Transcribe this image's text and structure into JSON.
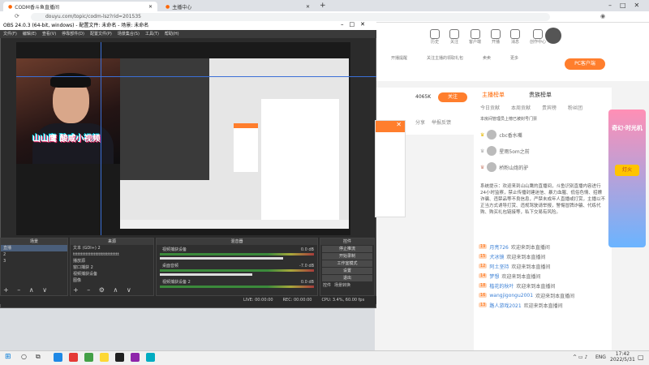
{
  "browser": {
    "tabs": [
      {
        "title": "CODM香斗鱼直播间"
      },
      {
        "title": "主播中心"
      }
    ],
    "new_tab": "+",
    "url": "douyu.com/topic/codm-lsz?rid=201535"
  },
  "obs": {
    "title": "OBS 24.0.3 (64-bit, windows) - 配置文件: 未命名 - 场景: 未命名",
    "menu": [
      "文件(F)",
      "编辑(E)",
      "查看(V)",
      "停靠部件(D)",
      "配置文件(P)",
      "场景集合(S)",
      "工具(T)",
      "帮助(H)"
    ],
    "watermark": "山山鹰  酸咸小视频",
    "docks": {
      "scenes": {
        "title": "场景",
        "items": [
          "直播",
          "2",
          "3"
        ]
      },
      "sources": {
        "title": "来源",
        "items": [
          "文本 (GDI+) 2",
          "ttttttttttttttttttttttttttttt",
          "播放源",
          "窗口捕获 2",
          "视频捕获设备",
          "图像"
        ]
      },
      "mixer": {
        "title": "混音器",
        "channels": [
          {
            "name": "视频捕获设备",
            "db": "0.0 dB"
          },
          {
            "name": "桌面音频",
            "db": "-7.0 dB"
          },
          {
            "name": "视频捕获设备 2",
            "db": "0.0 dB"
          }
        ]
      },
      "controls": {
        "title": "控件",
        "buttons": [
          "停止推流",
          "开始录制",
          "工作室模式",
          "设置",
          "退出"
        ],
        "tabs": [
          "控件",
          "场景转换"
        ]
      }
    },
    "status": [
      "LIVE: 00:00:00",
      "REC: 00:00:00",
      "CPU: 3.4%, 60.00 fps"
    ]
  },
  "douyu": {
    "nav": [
      "历史",
      "关注",
      "客户端",
      "开播",
      "消息",
      "创作中心"
    ],
    "pc_button": "PC客户端",
    "categories": [
      "开播提醒",
      "关注主播的领取礼包",
      "卖卖",
      "更多"
    ],
    "room_btns": [
      "分享",
      "举报反馈"
    ],
    "follow_count": "4065K",
    "follow_button": "关注",
    "panel_tabs": [
      "主播榜单",
      "贵族榜单"
    ],
    "sub_tabs": [
      "今日贡献",
      "本周贡献",
      "贵宾榜",
      "粉丝团"
    ],
    "notice": "本房间管理员上榜已被封号门票",
    "rank_users": [
      "cbc香水嘴",
      "星雨5om之前",
      "桥粉山炮的驴"
    ],
    "system_msg": "系统提示：欢迎来到山山鹰的直播间，斗鱼识别直播内容进行24小时监察，禁止传播封建迷信、暴力血腥、低俗色情、招嫖诈骗、违禁品等不良信息，严禁未成年人直播或打赏，主播以不正当方式诱导打赏、违规驾驶请举报，警惕冒牌诈骗、代练代购、购买礼包链接等，私下交易有风险。",
    "chat": [
      {
        "user": "月亮726",
        "text": "欢迎来到本直播间"
      },
      {
        "user": "犬冰镜",
        "text": "欢迎来到本直播间"
      },
      {
        "user": "阿土坚持",
        "text": "欢迎来到本直播间"
      },
      {
        "user": "梦想",
        "text": "欢迎来到本直播间"
      },
      {
        "user": "楷花的秋叶",
        "text": "欢迎来到本直播间"
      },
      {
        "user": "wangjigongu2001",
        "text": "欢迎来到本直播间"
      },
      {
        "user": "路人游戏2021",
        "text": "欢迎来到本直播间"
      }
    ],
    "promo": {
      "title": "奇幻·时光机",
      "items": [
        "灯火"
      ]
    }
  },
  "taskbar": {
    "lang": "ENG",
    "time": "17:42",
    "date": "2022/5/31",
    "icon_colors": [
      "#1e88e5",
      "#e53935",
      "#43a047",
      "#fdd835",
      "#212121",
      "#8e24aa",
      "#00acc1"
    ]
  }
}
